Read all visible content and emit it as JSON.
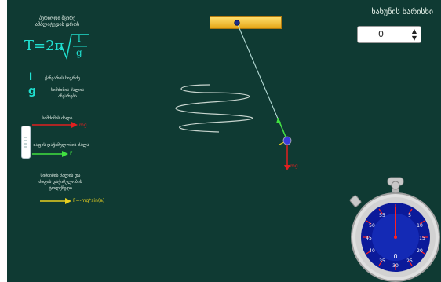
{
  "formula": {
    "prefix": "T=2π",
    "numerator": "l",
    "denominator": "g"
  },
  "left_panel": {
    "header": "პერიოდი მცირე\nამპლიტუდის დროს",
    "l_letter": "l",
    "l_desc": "ქანქარის სიგრძე",
    "g_letter": "g",
    "g_desc": "სიმძიმის ძალის\nაჩქარება",
    "gravity_label": "სიმძიმის ძალა",
    "gravity_arrow_text": "mg",
    "tension_label": "ძაფის დაჭიმულობის ძალა",
    "tension_arrow_text": "F",
    "sum_label": "სიმძიმის ძალის და\nძაფის დაჭიმულობის\nტოლქმედი",
    "sum_arrow_text": "F=-mg*sin(a)"
  },
  "top_right": {
    "title": "ხახუნის ხარისხი",
    "value": "0"
  },
  "pendulum": {
    "mg_label": "mg"
  },
  "stopwatch": {
    "ticks": [
      "55",
      "50",
      "45",
      "40",
      "35",
      "30",
      "25",
      "20",
      "15",
      "10",
      "5"
    ],
    "readout": "0"
  },
  "colors": {
    "background": "#0f3a33",
    "accent": "#20e0d0",
    "red": "#e02020",
    "green": "#40e040",
    "yellow": "#e8d020"
  }
}
